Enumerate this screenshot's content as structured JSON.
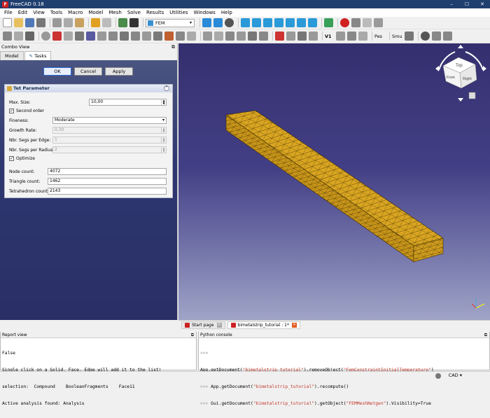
{
  "window": {
    "title": "FreeCAD 0.18",
    "minimize": "–",
    "maximize": "☐",
    "close": "✕"
  },
  "menu": [
    "File",
    "Edit",
    "View",
    "Tools",
    "Macro",
    "Model",
    "Mesh",
    "Solve",
    "Results",
    "Utilities",
    "Windows",
    "Help"
  ],
  "workbench": {
    "selected": "FEM"
  },
  "toolbar2_labels": {
    "fem_text": "Pes",
    "vis_text": "V1",
    "smu_text": "Smu"
  },
  "combo": {
    "title": "Combo View",
    "tabs": [
      "Model",
      "Tasks"
    ],
    "buttons": {
      "ok": "OK",
      "cancel": "Cancel",
      "apply": "Apply"
    },
    "tet": {
      "title": "Tet Parameter",
      "max_size_label": "Max. Size:",
      "max_size_value": "10,00",
      "second_order_label": "Second order",
      "second_order_checked": true,
      "fineness_label": "Fineness:",
      "fineness_value": "Moderate",
      "growth_rate_label": "Growth Rate:",
      "growth_rate_value": "0,30",
      "segs_edge_label": "Nbr. Segs per Edge:",
      "segs_edge_value": "1",
      "segs_radius_label": "Nbr. Segs per Radius:",
      "segs_radius_value": "2",
      "optimize_label": "Optimize",
      "optimize_checked": true,
      "node_count_label": "Node count:",
      "node_count_value": "4072",
      "triangle_count_label": "Triangle count:",
      "triangle_count_value": "1462",
      "tetra_count_label": "Tetrahedron count:",
      "tetra_count_value": "2143"
    }
  },
  "navcube": {
    "top": "Top",
    "right": "Right",
    "front": "Front"
  },
  "doc_tabs": [
    {
      "label": "Start page",
      "active": false
    },
    {
      "label": "bimetalstrip_tutorial : 1*",
      "active": true
    }
  ],
  "report": {
    "title": "Report view",
    "lines": [
      "False",
      "Single click on a Solid, Face, Edge will add it to the list!",
      "selection:  Compound    BooleanFragments    Face11",
      "Active analysis found: Analysis"
    ]
  },
  "python": {
    "title": "Python console",
    "prompt": ">>>",
    "line1": {
      "a": "App.getDocument(",
      "s1": "\"bimetalstrip_tutorial\"",
      "b": ").removeObject(",
      "s2": "\"FemConstraintInitialTemperature\"",
      "c": ")"
    },
    "line2": {
      "a": "App.getDocument(",
      "s1": "\"bimetalstrip_tutorial\"",
      "b": ").recompute()"
    },
    "line3": {
      "a": "Gui.getDocument(",
      "s1": "\"bimetalstrip_tutorial\"",
      "b": ").getObject(",
      "s2": "\"FEMMeshNetgen\"",
      "c": ").Visibility=True"
    }
  },
  "status": {
    "nav": "CAD"
  },
  "colors": {
    "mesh_fill": "#d9a521",
    "viewport_top": "#34306e",
    "viewport_bottom": "#a0a4c6",
    "title_bar": "#1f3f6f"
  }
}
